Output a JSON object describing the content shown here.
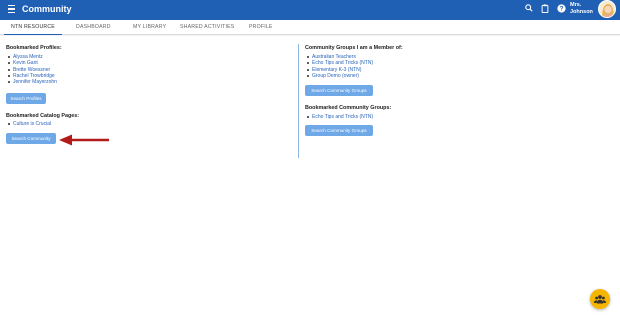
{
  "appbar": {
    "title": "Community",
    "user_name_line1": "Mrs.",
    "user_name_line2": "Johnson"
  },
  "tabs": [
    {
      "label": "NTN RESOURCE LIBRARY",
      "active": true
    },
    {
      "label": "DASHBOARD",
      "active": false
    },
    {
      "label": "MY LIBRARY",
      "active": false
    },
    {
      "label": "SHARED ACTIVITIES",
      "active": false
    },
    {
      "label": "PROFILE",
      "active": false
    }
  ],
  "left": {
    "bookmarked_profiles_title": "Bookmarked Profiles:",
    "profiles": [
      "Alyssa Mentz",
      "Kevin Gant",
      "Brette Woessner",
      "Rachel Trowbridge",
      "Jennifer Mayerzohn"
    ],
    "search_profiles_label": "Search Profiles",
    "catalog_title": "Bookmarked Catalog Pages:",
    "catalog_pages": [
      "Culture is Crucial"
    ],
    "search_community_label": "Search Community"
  },
  "right": {
    "member_groups_title": "Community Groups I am a Member of:",
    "member_groups": [
      "Australian Teachers",
      "Echo Tips and Tricks (NTN)",
      "Elementary K-3 (NTN)",
      "Group Demo (owner)"
    ],
    "search_groups_label_1": "Search Community Groups",
    "bookmarked_groups_title": "Bookmarked Community Groups:",
    "bookmarked_groups": [
      "Echo Tips and Tricks (NTN)"
    ],
    "search_groups_label_2": "Search Community Groups"
  },
  "colors": {
    "appbar": "#1f5fb4",
    "button": "#6fa8e6",
    "link": "#2a64b8",
    "fab": "#f5b500",
    "arrow": "#b31b1b"
  },
  "icons": [
    "menu-icon",
    "search-icon",
    "clipboard-icon",
    "help-icon",
    "group-icon"
  ]
}
